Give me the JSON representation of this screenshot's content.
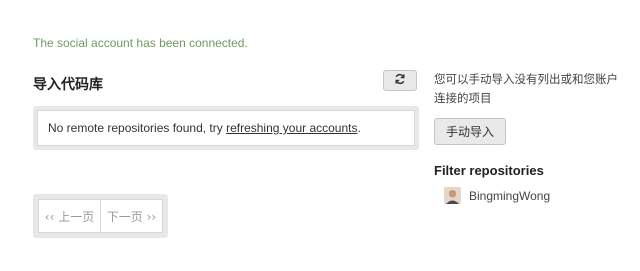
{
  "flash": {
    "message": "The social account has been connected."
  },
  "import": {
    "title": "导入代码库",
    "refresh_icon": "refresh-icon",
    "notice_prefix": "No remote repositories found, try ",
    "notice_link": "refreshing your accounts",
    "notice_suffix": "."
  },
  "pagination": {
    "prev": "‹‹ 上一页",
    "next": "下一页 ››"
  },
  "sidebar": {
    "manual_text": "您可以手动导入没有列出或和您账户连接的项目",
    "manual_button": "手动导入",
    "filter_title": "Filter repositories",
    "accounts": [
      {
        "name": "BingmingWong",
        "icon": "avatar-icon"
      }
    ]
  },
  "colors": {
    "flash_text": "#6f9a5f",
    "panel_bg": "#e8e8e8",
    "button_bg": "#e9e9e9"
  }
}
